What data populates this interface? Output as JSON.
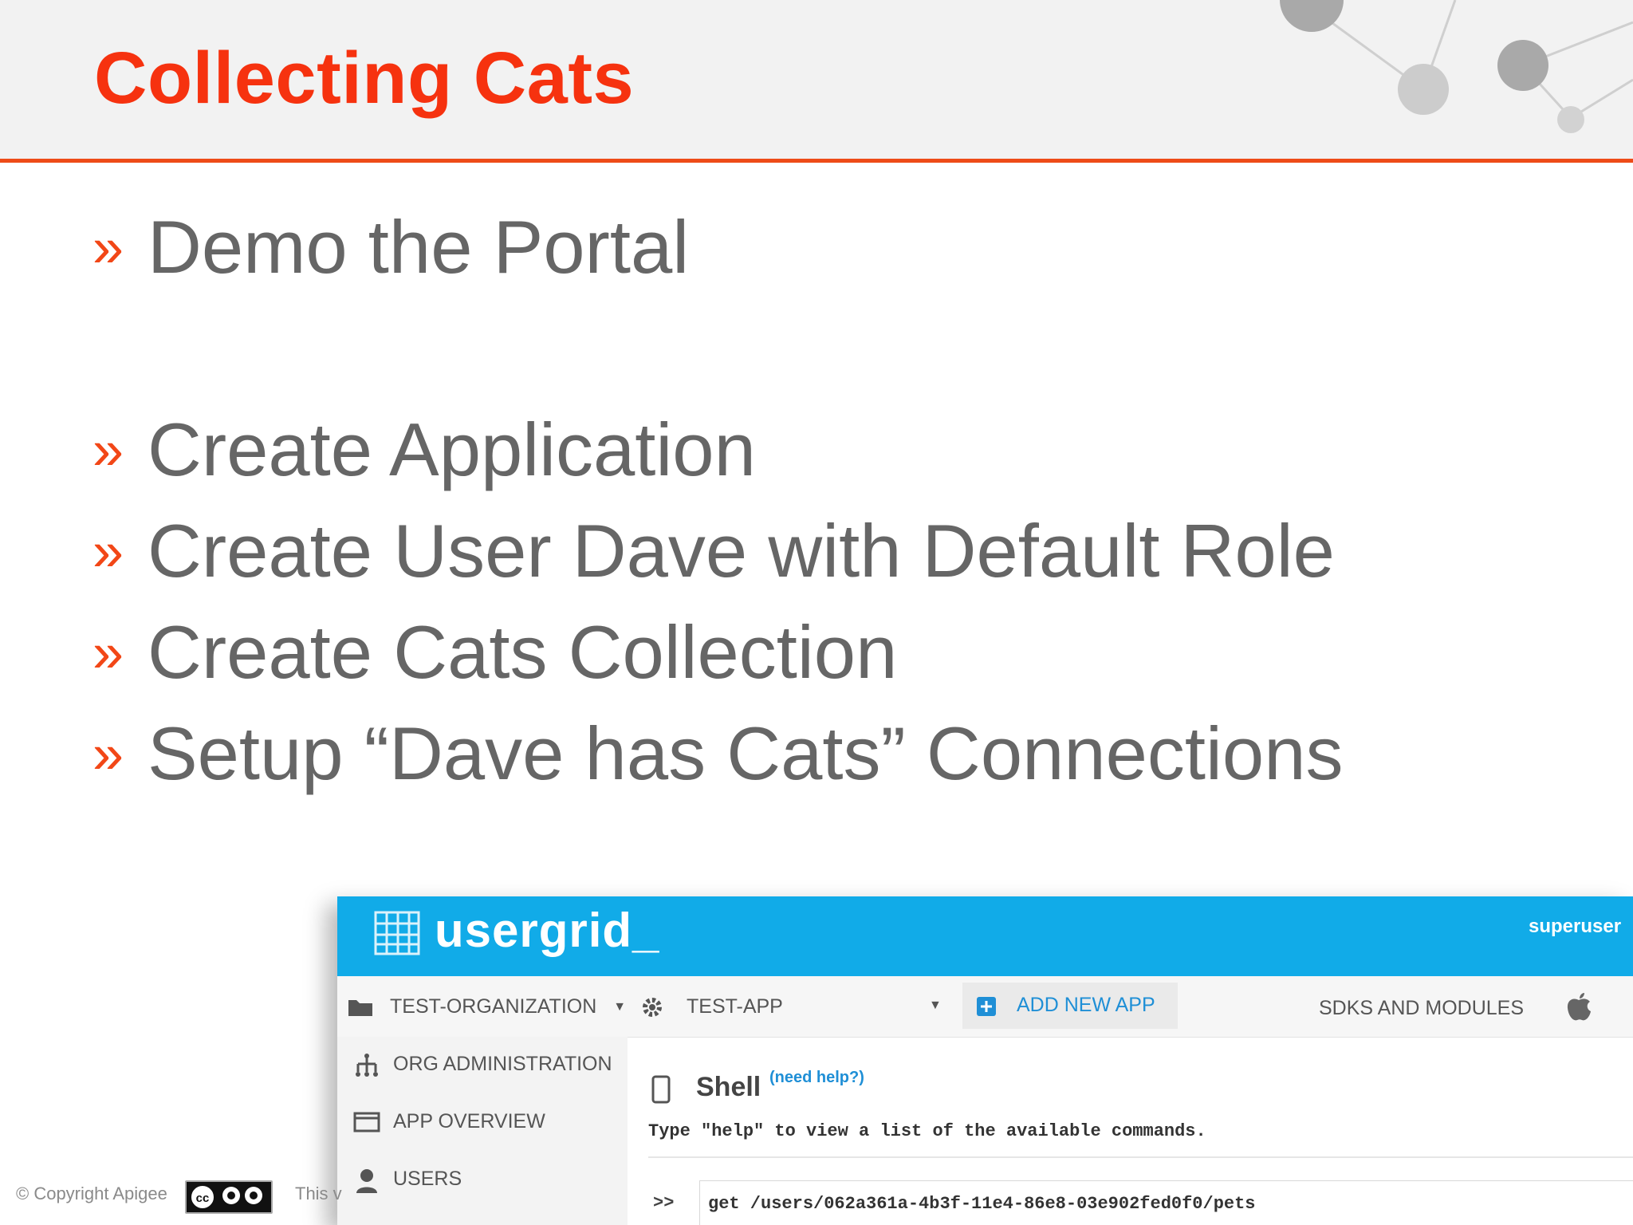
{
  "slide": {
    "title": "Collecting Cats",
    "bullet_marker": "»",
    "bullets": [
      "Demo the Portal",
      "Create Application",
      "Create User Dave with Default Role",
      "Create Cats Collection",
      "Setup “Dave has Cats” Connections"
    ],
    "footer": {
      "copyright": "© Copyright Apigee",
      "truncated_text": "This v"
    }
  },
  "usergrid": {
    "logo": "usergrid_",
    "user": "superuser",
    "toolbar": {
      "organization": "TEST-ORGANIZATION",
      "app": "TEST-APP",
      "add_app": "ADD NEW APP",
      "sdks": "SDKS AND MODULES"
    },
    "sidebar": [
      {
        "label": "ORG ADMINISTRATION",
        "icon": "org-tree-icon"
      },
      {
        "label": "APP OVERVIEW",
        "icon": "window-icon"
      },
      {
        "label": "USERS",
        "icon": "user-icon"
      }
    ],
    "shell": {
      "title": "Shell",
      "help_link": "(need help?)",
      "hint": "Type \"help\" to view a list of the available commands.",
      "prompt": ">>",
      "command": "get /users/062a361a-4b3f-11e4-86e8-03e902fed0f0/pets"
    }
  },
  "colors": {
    "title_red": "#f6320f",
    "accent_orange": "#ee4b18",
    "bullet_gray": "#666666",
    "usergrid_blue": "#11abe8",
    "link_blue": "#1f8fd6"
  }
}
